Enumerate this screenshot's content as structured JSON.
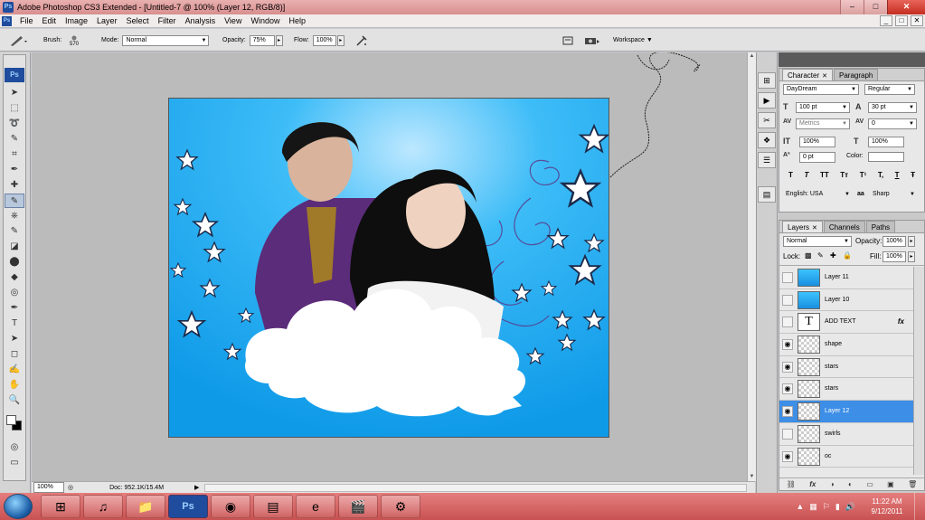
{
  "window": {
    "title": "Adobe Photoshop CS3 Extended - [Untitled-7 @ 100% (Layer 12, RGB/8)]",
    "logo": "Ps",
    "minimize": "–",
    "maximize": "□",
    "close": "✕"
  },
  "doc_window_buttons": [
    "_",
    "□",
    "✕"
  ],
  "menu": [
    "File",
    "Edit",
    "Image",
    "Layer",
    "Select",
    "Filter",
    "Analysis",
    "View",
    "Window",
    "Help"
  ],
  "options": {
    "brush_label": "Brush:",
    "brush_size": "570",
    "mode_label": "Mode:",
    "mode_value": "Normal",
    "opacity_label": "Opacity:",
    "opacity_value": "75%",
    "flow_label": "Flow:",
    "flow_value": "100%",
    "workspace_label": "Workspace ▼"
  },
  "tools": {
    "logo": "Ps",
    "glyphs": [
      "➤",
      "⬚",
      "➰",
      "✎",
      "⌗",
      "✒",
      "✚",
      "✎",
      "⎈",
      "✎",
      "◪",
      "⬤",
      "◆",
      "◎",
      "✒",
      "T",
      "➤",
      "◻",
      "✍",
      "✋",
      "🔍"
    ],
    "active_index": 9
  },
  "status": {
    "zoom": "100%",
    "doc_info": "Doc: 952.1K/15.4M"
  },
  "dock_icons": [
    "⊞",
    "▶",
    "✂",
    "❖",
    "☰",
    "▤"
  ],
  "character": {
    "tabs": [
      {
        "label": "Character",
        "active": true
      },
      {
        "label": "Paragraph",
        "active": false
      }
    ],
    "font_family": "DayDream",
    "font_style": "Regular",
    "font_size": "100 pt",
    "leading": "30 pt",
    "kerning": "Metrics",
    "tracking": "0",
    "vscale": "100%",
    "hscale": "100%",
    "baseline": "0 pt",
    "color_label": "Color:",
    "style_buttons": [
      "T",
      "T",
      "TT",
      "Tт",
      "T¹",
      "T,",
      "T",
      "Ŧ"
    ],
    "language": "English: USA",
    "antialias_icon": "aa",
    "antialias": "Sharp"
  },
  "layers": {
    "tabs": [
      {
        "label": "Layers",
        "active": true
      },
      {
        "label": "Channels",
        "active": false
      },
      {
        "label": "Paths",
        "active": false
      }
    ],
    "blend_mode": "Normal",
    "opacity_label": "Opacity:",
    "opacity": "100%",
    "lock_label": "Lock:",
    "lock_icons": [
      "▩",
      "✎",
      "✚",
      "🔒"
    ],
    "fill_label": "Fill:",
    "fill": "100%",
    "items": [
      {
        "name": "Layer 11",
        "visible": false,
        "thumb": "img",
        "selected": false,
        "fx": ""
      },
      {
        "name": "Layer 10",
        "visible": false,
        "thumb": "img",
        "selected": false,
        "fx": ""
      },
      {
        "name": "ADD TEXT",
        "visible": false,
        "thumb": "text",
        "selected": false,
        "fx": "fx"
      },
      {
        "name": "shape",
        "visible": true,
        "thumb": "trans",
        "selected": false,
        "fx": ""
      },
      {
        "name": "stars",
        "visible": true,
        "thumb": "trans",
        "selected": false,
        "fx": ""
      },
      {
        "name": "stars",
        "visible": true,
        "thumb": "trans",
        "selected": false,
        "fx": ""
      },
      {
        "name": "Layer 12",
        "visible": true,
        "thumb": "trans",
        "selected": true,
        "fx": ""
      },
      {
        "name": "swirls",
        "visible": false,
        "thumb": "trans",
        "selected": false,
        "fx": ""
      },
      {
        "name": "oc",
        "visible": true,
        "thumb": "trans",
        "selected": false,
        "fx": ""
      }
    ],
    "footer_icons": [
      "⛓",
      "fx",
      "◑",
      "◐",
      "▭",
      "▣",
      "🗑"
    ]
  },
  "taskbar": {
    "apps": [
      "⊞",
      "♫",
      "📁",
      "Ps",
      "◉",
      "▤",
      "e",
      "🎬",
      "⚙"
    ],
    "active_index": 3,
    "clock_time": "11:22 AM",
    "clock_date": "9/12/2011",
    "tray_icons": [
      "▲",
      "▦",
      "⚐",
      "▮",
      "🔊"
    ]
  },
  "colors": {
    "title_bar": "#d88f8f",
    "selection": "#3d8ee6",
    "canvas_sky": "#18a8f0",
    "taskbar": "#c95252"
  }
}
